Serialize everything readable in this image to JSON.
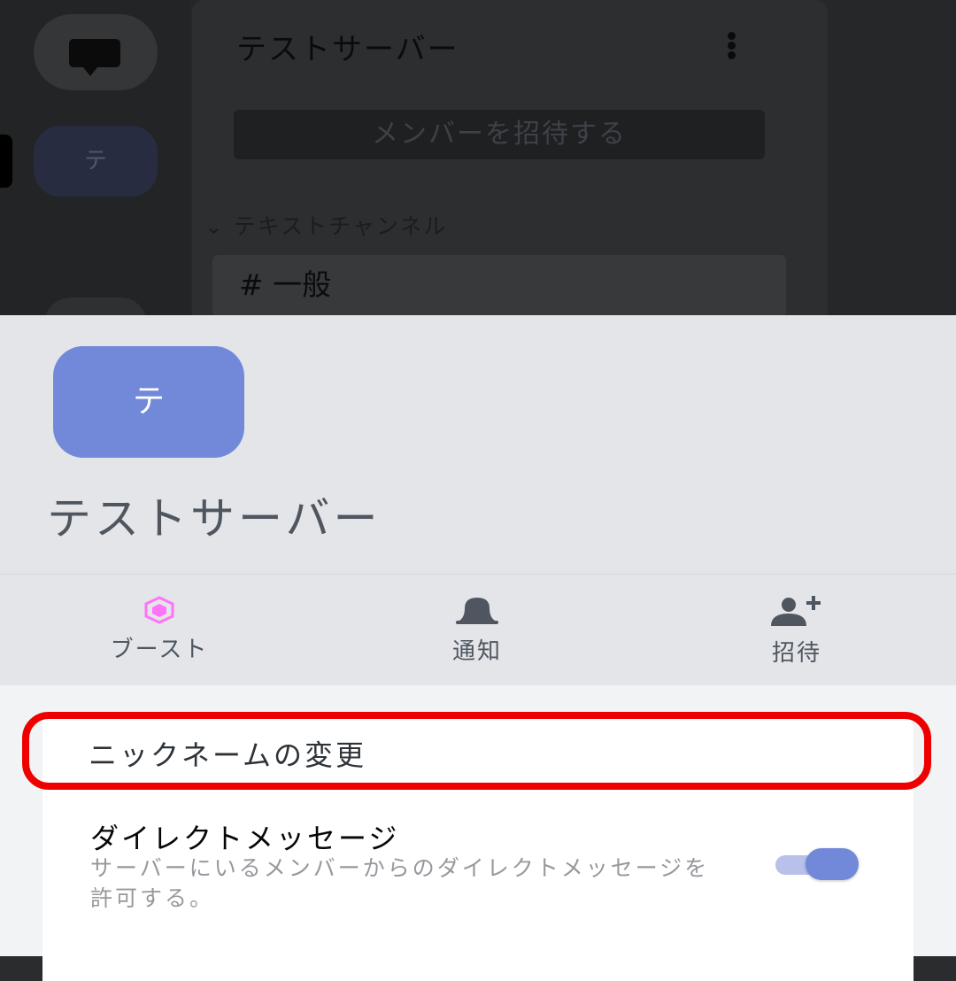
{
  "background": {
    "server_title": "テストサーバー",
    "server_icon_letter": "テ",
    "invite_button_label": "メンバーを招待する",
    "category_label": "テキストチャンネル",
    "channel": {
      "prefix": "#",
      "name": "一般"
    }
  },
  "sheet": {
    "server_icon_letter": "テ",
    "server_name": "テストサーバー",
    "actions": [
      {
        "label": "ブースト",
        "icon": "boost-icon",
        "color": "#ff73fa"
      },
      {
        "label": "通知",
        "icon": "bell-icon",
        "color": "#4f5660"
      },
      {
        "label": "招待",
        "icon": "add-member-icon",
        "color": "#4f5660"
      }
    ],
    "settings": {
      "nickname_label": "ニックネームの変更",
      "direct_messages": {
        "title": "ダイレクトメッセージ",
        "description": "サーバーにいるメンバーからのダイレクトメッセージを許可する。",
        "enabled": true
      }
    }
  },
  "colors": {
    "accent": "#7289d9",
    "highlight": "#ee0000"
  }
}
